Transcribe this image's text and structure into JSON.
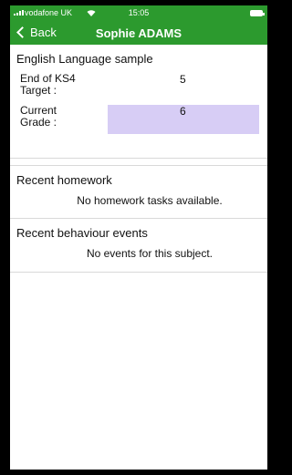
{
  "status_bar": {
    "carrier": "vodafone UK",
    "time": "15:05"
  },
  "nav": {
    "back_label": "Back",
    "title": "Sophie ADAMS"
  },
  "subject": {
    "title": "English Language sample",
    "rows": [
      {
        "label": "End of KS4 Target :",
        "value": "5",
        "highlighted": false
      },
      {
        "label": "Current Grade :",
        "value": "6",
        "highlighted": true
      }
    ]
  },
  "homework": {
    "title": "Recent homework",
    "empty_message": "No homework tasks available."
  },
  "behaviour": {
    "title": "Recent behaviour events",
    "empty_message": "No events for this subject."
  },
  "colors": {
    "header_green": "#2c9a2e",
    "highlight_lavender": "#d7cdf5"
  }
}
